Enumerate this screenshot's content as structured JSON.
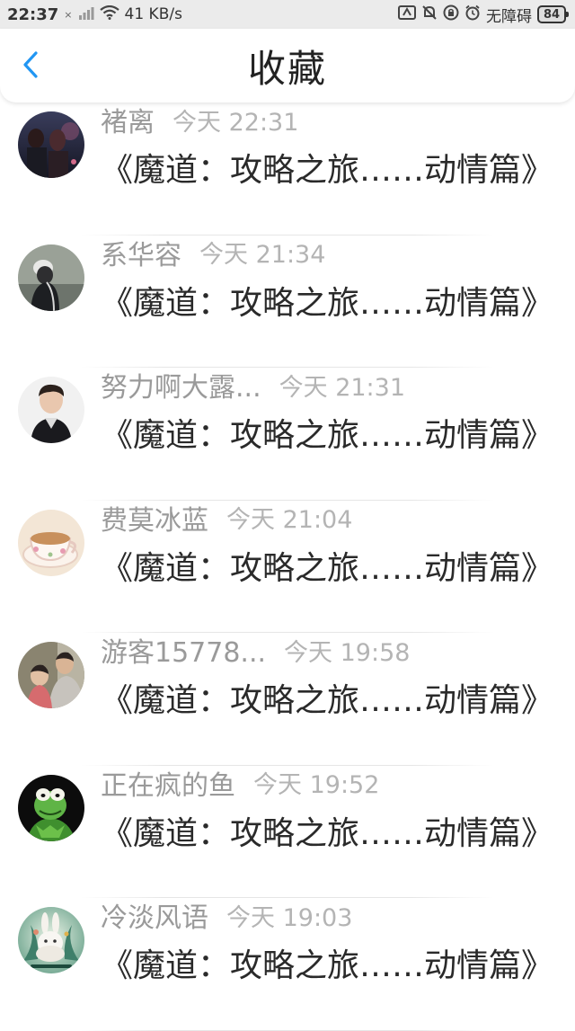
{
  "status_bar": {
    "time": "22:37",
    "network_speed": "41 KB/s",
    "sim_label": "×",
    "mode_label": "无障碍",
    "battery": "84",
    "icons": [
      "signal-icon",
      "wifi-icon",
      "accessibility-icon",
      "bell-muted-icon",
      "lock-rotation-icon",
      "alarm-icon"
    ]
  },
  "header": {
    "title": "收藏",
    "back_icon": "chevron-left-icon",
    "accent_color": "#2196f3"
  },
  "items": [
    {
      "username": "褚离",
      "time": "今天 22:31",
      "title": "《魔道：攻略之旅……动情篇》",
      "avatar": "avatar-couple-night"
    },
    {
      "username": "系华容",
      "time": "今天 21:34",
      "title": "《魔道：攻略之旅……动情篇》",
      "avatar": "avatar-girl-cap"
    },
    {
      "username": "努力啊大露...",
      "time": "今天 21:31",
      "title": "《魔道：攻略之旅……动情篇》",
      "avatar": "avatar-man-portrait"
    },
    {
      "username": "费莫冰蓝",
      "time": "今天 21:04",
      "title": "《魔道：攻略之旅……动情篇》",
      "avatar": "avatar-teacup"
    },
    {
      "username": "游客15778...",
      "time": "今天 19:58",
      "title": "《魔道：攻略之旅……动情篇》",
      "avatar": "avatar-family-photo"
    },
    {
      "username": "正在疯的鱼",
      "time": "今天 19:52",
      "title": "《魔道：攻略之旅……动情篇》",
      "avatar": "avatar-green-frog"
    },
    {
      "username": "冷淡风语",
      "time": "今天 19:03",
      "title": "《魔道：攻略之旅……动情篇》",
      "avatar": "avatar-rabbit-illustration"
    }
  ]
}
